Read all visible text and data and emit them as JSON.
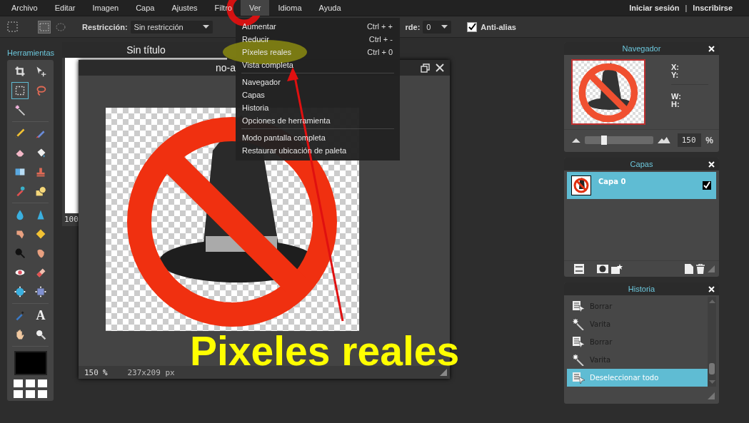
{
  "menu_bar": {
    "items": [
      {
        "label": "Archivo",
        "selected": false
      },
      {
        "label": "Editar",
        "selected": false
      },
      {
        "label": "Imagen",
        "selected": false
      },
      {
        "label": "Capa",
        "selected": false
      },
      {
        "label": "Ajustes",
        "selected": false
      },
      {
        "label": "Filtro",
        "selected": false
      },
      {
        "label": "Ver",
        "selected": true
      },
      {
        "label": "Idioma",
        "selected": false
      },
      {
        "label": "Ayuda",
        "selected": false
      }
    ],
    "account": [
      {
        "label": "Iniciar sesión"
      },
      {
        "label": "Inscribirse"
      }
    ],
    "separator": "|"
  },
  "toolbar": {
    "restriction_label": "Restricción:",
    "restriction_value": "Sin restricción",
    "border_label": "rde:",
    "border_value": "0",
    "antialias": {
      "label": "Anti-alias",
      "checked": true
    }
  },
  "view_menu": {
    "sections": [
      [
        {
          "label": "Aumentar",
          "shortcut": "Ctrl + +"
        },
        {
          "label": "Reducir",
          "shortcut": "Ctrl + -"
        },
        {
          "label": "Píxeles reales",
          "shortcut": "Ctrl + 0"
        },
        {
          "label": "Vista completa"
        }
      ],
      [
        {
          "label": "Navegador"
        },
        {
          "label": "Capas"
        },
        {
          "label": "Historia"
        },
        {
          "label": "Opciones de herramienta"
        }
      ],
      [
        {
          "label": "Modo pantalla completa"
        },
        {
          "label": "Restaurar ubicación de paleta"
        }
      ]
    ]
  },
  "tools_panel": {
    "title": "Herramientas",
    "tools": [
      {
        "selected": false
      },
      {
        "selected": false
      },
      {
        "selected": true
      },
      {
        "selected": false
      },
      {
        "selected": false
      },
      {
        "selected": false
      },
      {
        "selected": false
      },
      {
        "selected": false
      },
      {
        "selected": false
      },
      {
        "selected": false
      },
      {
        "selected": false
      },
      {
        "selected": false
      },
      {
        "selected": false
      },
      {
        "selected": false
      },
      {
        "selected": false
      },
      {
        "selected": false
      },
      {
        "selected": false
      },
      {
        "selected": false
      },
      {
        "selected": false
      },
      {
        "selected": false
      },
      {
        "selected": false
      },
      {
        "selected": false
      },
      {
        "selected": false
      },
      {
        "selected": false
      },
      {
        "selected": false,
        "glyph": "A"
      },
      {
        "selected": false
      },
      {
        "selected": false
      }
    ],
    "color": "#000000"
  },
  "documents": [
    {
      "title": "Sin título",
      "zoom": "100"
    },
    {
      "title": "no-a",
      "zoom": "150",
      "zoom_unit": "%",
      "size": "237x209 px"
    }
  ],
  "navigator": {
    "title": "Navegador",
    "x_label": "X:",
    "y_label": "Y:",
    "w_label": "W:",
    "h_label": "H:",
    "level": 0.28,
    "zoom": "150",
    "unit": "%"
  },
  "layers": {
    "title": "Capas",
    "items": [
      {
        "name": "Capa 0",
        "selected": true,
        "checked": true
      }
    ]
  },
  "history": {
    "title": "Historia",
    "items": [
      {
        "label": "Borrar",
        "kind": "erase",
        "disabled": true,
        "selected": false
      },
      {
        "label": "Varita",
        "kind": "wand",
        "disabled": true,
        "selected": false
      },
      {
        "label": "Borrar",
        "kind": "erase",
        "disabled": true,
        "selected": false
      },
      {
        "label": "Varita",
        "kind": "wand",
        "disabled": true,
        "selected": false
      },
      {
        "label": "Deseleccionar todo",
        "kind": "erase",
        "disabled": false,
        "selected": true
      }
    ]
  },
  "annotation": {
    "caption": "Pixeles reales"
  }
}
